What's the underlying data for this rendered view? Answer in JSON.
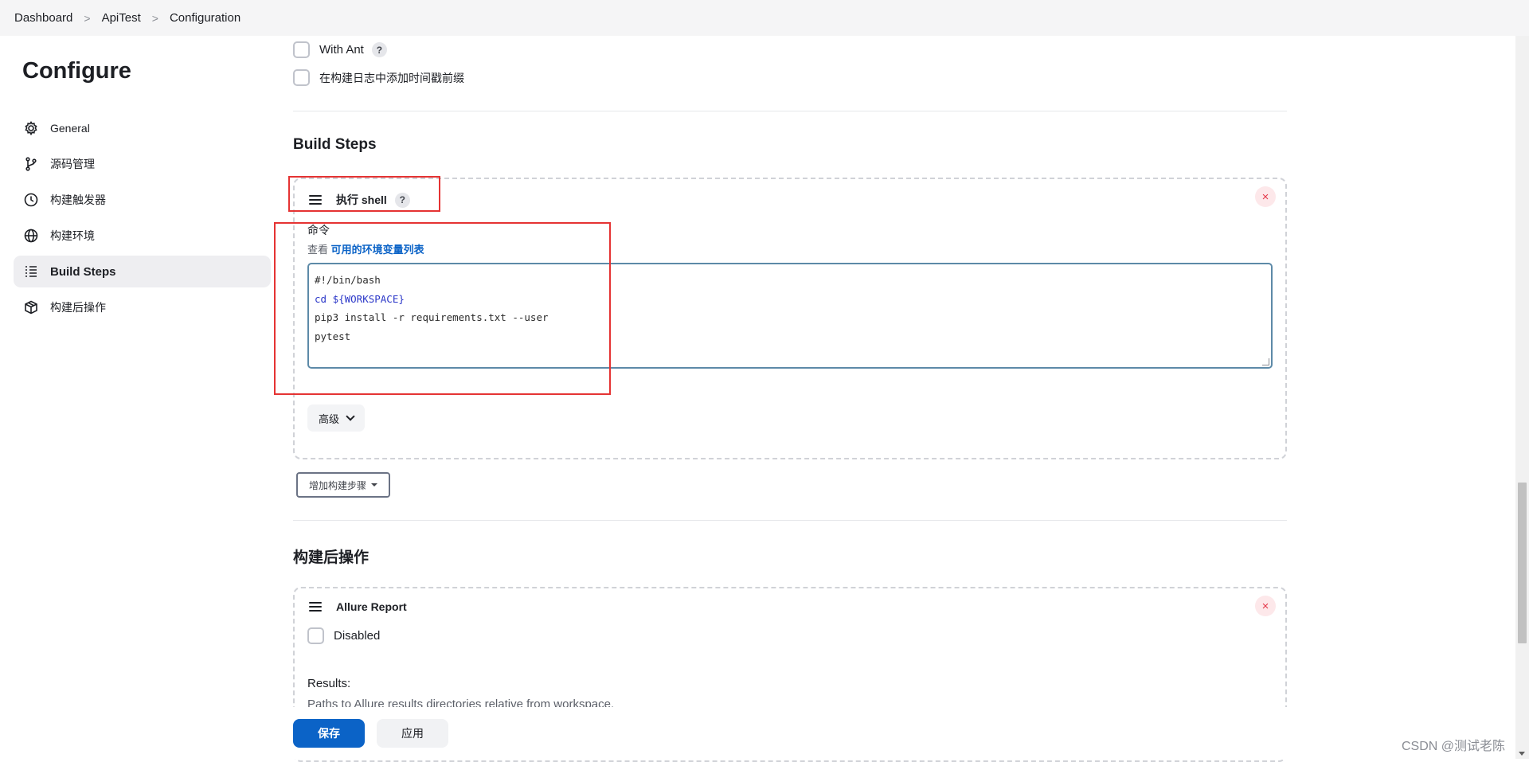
{
  "breadcrumb": {
    "items": [
      "Dashboard",
      "ApiTest",
      "Configuration"
    ]
  },
  "sidebar": {
    "title": "Configure",
    "items": [
      {
        "label": "General",
        "icon": "gear-icon",
        "active": false
      },
      {
        "label": "源码管理",
        "icon": "branch-icon",
        "active": false
      },
      {
        "label": "构建触发器",
        "icon": "clock-icon",
        "active": false
      },
      {
        "label": "构建环境",
        "icon": "globe-icon",
        "active": false
      },
      {
        "label": "Build Steps",
        "icon": "list-icon",
        "active": true
      },
      {
        "label": "构建后操作",
        "icon": "package-icon",
        "active": false
      }
    ]
  },
  "build_env": {
    "with_ant_label": "With Ant",
    "with_ant_help": "?",
    "timestamp_label": "在构建日志中添加时间戳前缀"
  },
  "build_steps": {
    "title": "Build Steps",
    "shell_step": {
      "title": "执行 shell",
      "help": "?",
      "command_label": "命令",
      "env_prefix": "查看",
      "env_link": "可用的环境变量列表",
      "command_lines": [
        "#!/bin/bash",
        "cd ${WORKSPACE}",
        "pip3 install -r requirements.txt --user",
        "pytest"
      ],
      "advanced_label": "高级"
    },
    "add_step_label": "增加构建步骤"
  },
  "post_build": {
    "title": "构建后操作",
    "allure": {
      "title": "Allure Report",
      "disabled_label": "Disabled",
      "results_label": "Results:",
      "results_desc": "Paths to Allure results directories relative from workspace."
    }
  },
  "footer": {
    "save_label": "保存",
    "apply_label": "应用"
  },
  "watermark": "CSDN @测试老陈",
  "colors": {
    "primary": "#0b63c7",
    "highlight": "#e53333",
    "close": "#e5384a"
  }
}
